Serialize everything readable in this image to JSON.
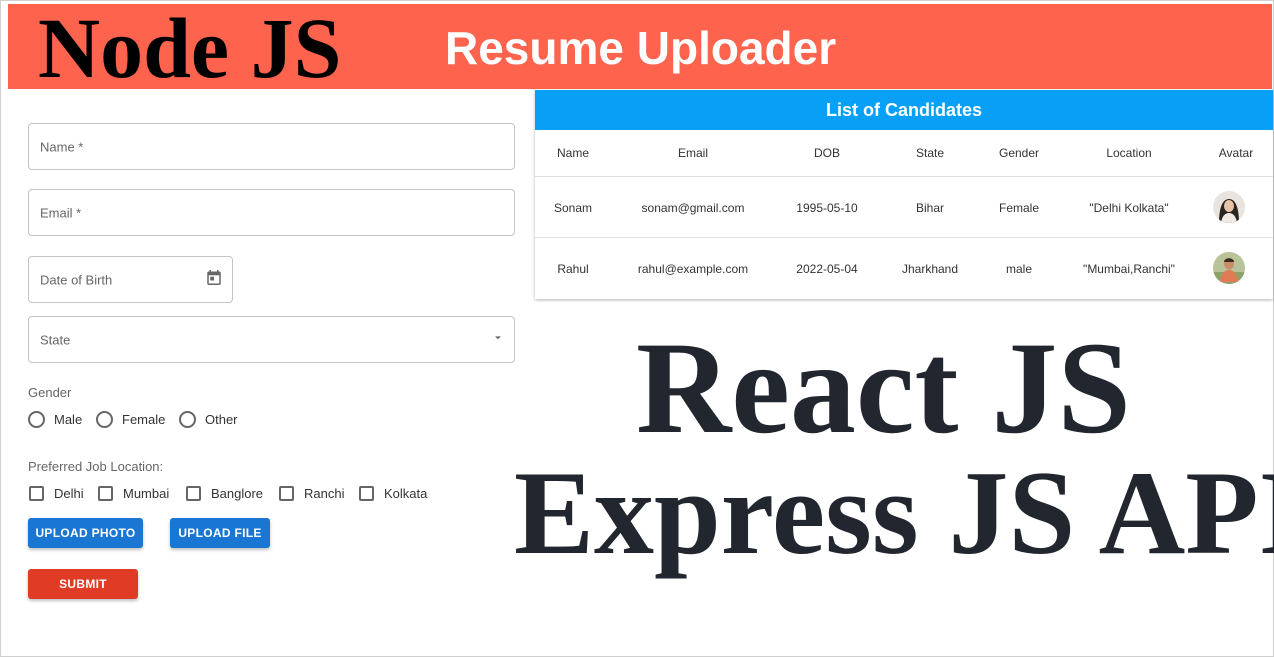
{
  "banner": {
    "brand": "Node JS",
    "subtitle": "Resume Uploader",
    "bg_color": "#fe634e"
  },
  "form": {
    "name_label": "Name *",
    "email_label": "Email *",
    "dob_label": "Date of Birth",
    "state_label": "State",
    "gender_label": "Gender",
    "gender_options": [
      "Male",
      "Female",
      "Other"
    ],
    "location_label": "Preferred Job Location:",
    "location_options": [
      "Delhi",
      "Mumbai",
      "Banglore",
      "Ranchi",
      "Kolkata"
    ],
    "upload_photo": "UPLOAD PHOTO",
    "upload_file": "UPLOAD FILE",
    "submit": "SUBMIT",
    "icons": {
      "dob": "calendar-icon",
      "state": "dropdown-arrow-icon"
    }
  },
  "table": {
    "title": "List of Candidates",
    "title_color": "#07a0f6",
    "headers": [
      "Name",
      "Email",
      "DOB",
      "State",
      "Gender",
      "Location",
      "Avatar"
    ],
    "rows": [
      [
        "Sonam",
        "sonam@gmail.com",
        "1995-05-10",
        "Bihar",
        "Female",
        "\"Delhi Kolkata\""
      ],
      [
        "Rahul",
        "rahul@example.com",
        "2022-05-04",
        "Jharkhand",
        "male",
        "\"Mumbai,Ranchi\""
      ]
    ]
  },
  "overlay": {
    "line1": "React JS",
    "line2": "Express JS API"
  }
}
